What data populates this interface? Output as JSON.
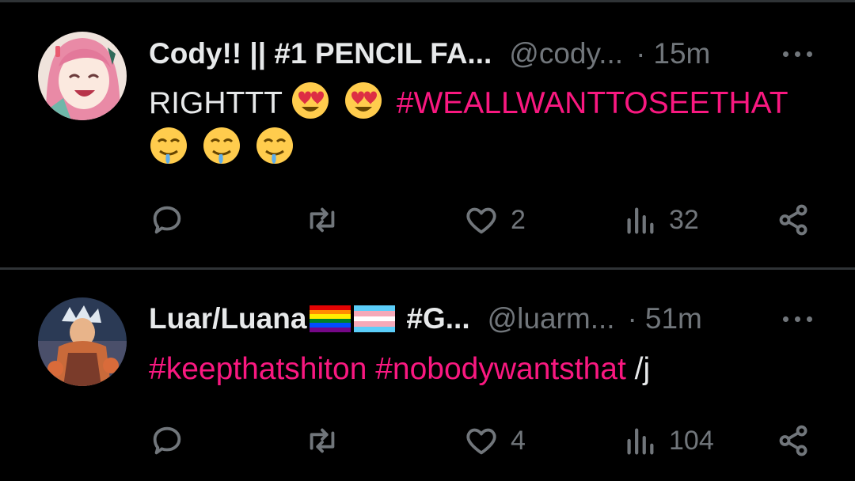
{
  "colors": {
    "background": "#000000",
    "hashtag": "#f91880",
    "muted": "#71767b",
    "text": "#e7e9ea",
    "divider": "#2f3336"
  },
  "tweets": [
    {
      "display_name": "Cody!! || #1 PENCIL FA...",
      "handle": "@cody...",
      "separator": "·",
      "time": "15m",
      "text_plain": "RIGHTTT",
      "hashtag": "#WEALLWANTTOSEETHAT",
      "emojis": [
        "heart-eyes-emoji",
        "heart-eyes-emoji",
        "drooling-emoji",
        "drooling-emoji",
        "drooling-emoji"
      ],
      "likes": "2",
      "views": "32"
    },
    {
      "display_name_1": "Luar/Luana",
      "display_name_2": "#G...",
      "flags": [
        "rainbow-flag",
        "transgender-flag"
      ],
      "handle": "@luarm...",
      "separator": "·",
      "time": "51m",
      "hashtag_1": "#keepthatshiton",
      "hashtag_2": "#nobodywantsthat",
      "suffix": "/j",
      "likes": "4",
      "views": "104"
    }
  ],
  "icons": {
    "reply": "reply-icon",
    "retweet": "retweet-icon",
    "like": "heart-icon",
    "views": "views-icon",
    "share": "share-icon",
    "more": "more-icon"
  }
}
